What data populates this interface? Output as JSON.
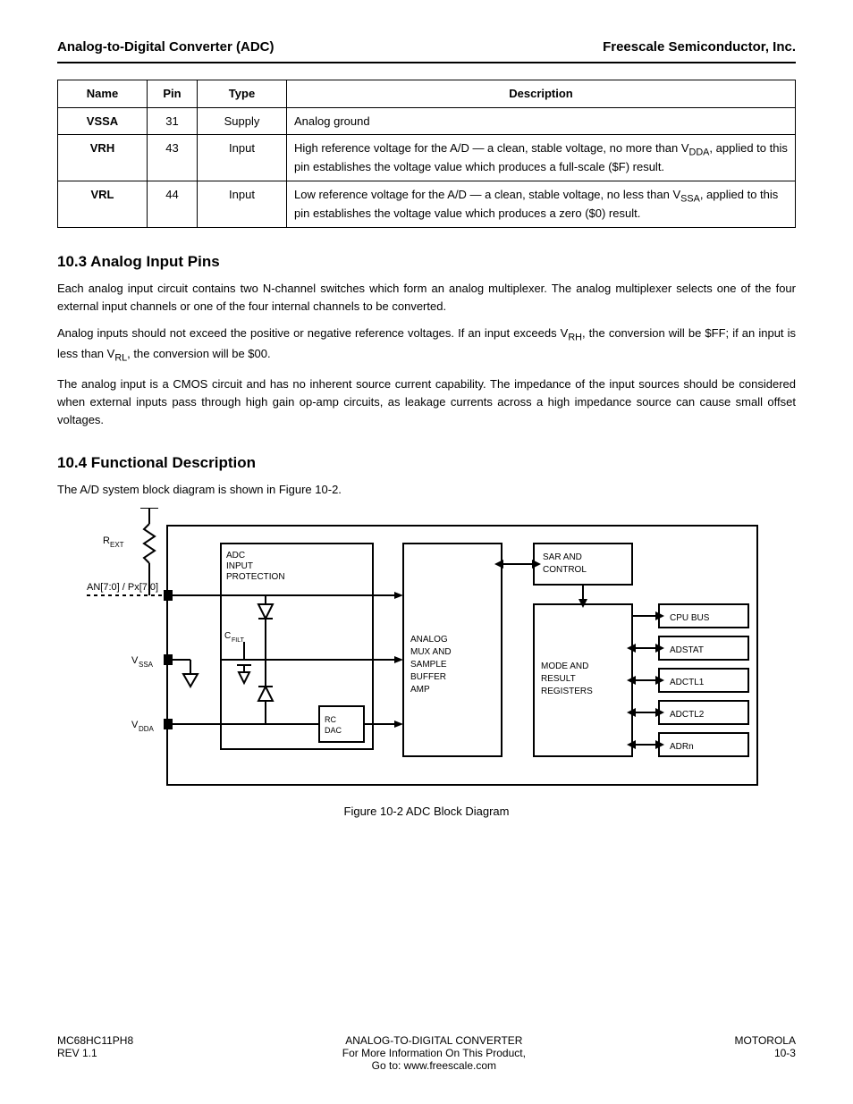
{
  "header": {
    "left": "Analog-to-Digital Converter (ADC)",
    "right": "Freescale Semiconductor, Inc."
  },
  "table": {
    "headers": [
      "Name",
      "Pin",
      "Type",
      "Description"
    ],
    "rows": [
      {
        "name": "VSSA",
        "pin": "31",
        "type": "Supply",
        "desc": "Analog ground"
      },
      {
        "name": "VRH",
        "pin": "43",
        "type": "Input",
        "desc": "High reference voltage for the A/D — a clean, stable voltage, no more than V<sub>DDA</sub>, applied to this pin establishes the voltage value which produces a full-scale ($F) result."
      },
      {
        "name": "VRL",
        "pin": "44",
        "type": "Input",
        "desc": "Low reference voltage for the A/D — a clean, stable voltage, no less than V<sub>SSA</sub>, applied to this pin establishes the voltage value which produces a zero ($0) result."
      }
    ]
  },
  "section1": {
    "title": "10.3 Analog Input Pins",
    "paras": [
      "Each analog input circuit contains two N-channel switches which form an analog multiplexer. The analog multiplexer selects one of the four external input channels or one of the four internal channels to be converted.",
      "Analog inputs should not exceed the positive or negative reference voltages. If an input exceeds V<sub>RH</sub>, the conversion will be $FF; if an input is less than V<sub>RL</sub>, the conversion will be $00.",
      "The analog input is a CMOS circuit and has no inherent source current capability. The impedance of the input sources should be considered when external inputs pass through high gain op-amp circuits, as leakage currents across a high impedance source can cause small offset voltages."
    ]
  },
  "section2": {
    "title": "10.4 Functional Description",
    "paras": [
      "The A/D system block diagram is shown in Figure 10-2."
    ]
  },
  "figure": {
    "caption": "Figure 10-2 ADC Block Diagram",
    "labels": {
      "pxX": "AN[7:0] / Px[7:0]",
      "rext": "R<sub>EXT</sub>",
      "vssa": "V<sub>SSA</sub>",
      "vdda": "V<sub>DDA</sub>",
      "cfilt": "C<sub>FILT</sub>",
      "rcdac": "RC DAC",
      "analogMux": "ANALOG\nMUX AND\nSAMPLE\nBUFFER\nAMP",
      "aip": "ADC\nINPUT\nPROTECTION",
      "sar": "SAR AND\nCONTROL",
      "modeRes": "MODE AND\nRESULT\nREGISTERS",
      "cpu": "CPU BUS",
      "adstat": "ADSTAT",
      "adctl": "ADCTL1",
      "adctl2": "ADCTL2",
      "adr": "ADRn"
    }
  },
  "footer": {
    "left": "MC68HC11PH8\nREV 1.1",
    "center": "ANALOG-TO-DIGITAL CONVERTER\nFor More Information On This Product,\nGo to: www.freescale.com",
    "right": "MOTOROLA\n10-3"
  }
}
